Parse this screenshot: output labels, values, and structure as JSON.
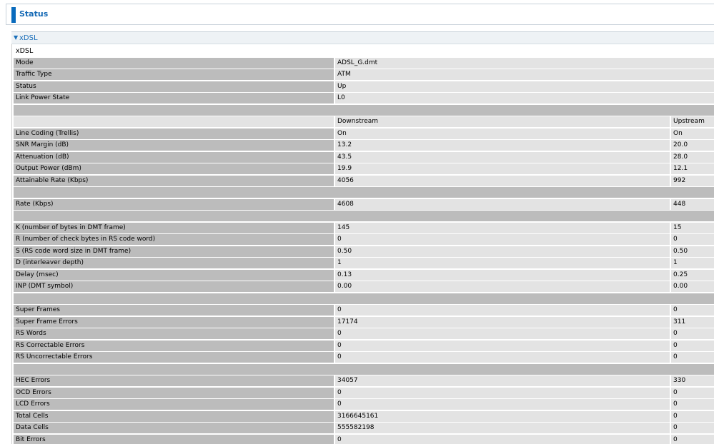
{
  "header": {
    "title": "Status"
  },
  "section": {
    "title": "xDSL"
  },
  "table": {
    "title": "xDSL",
    "info": [
      {
        "label": "Mode",
        "value": "ADSL_G.dmt"
      },
      {
        "label": "Traffic Type",
        "value": "ATM"
      },
      {
        "label": "Status",
        "value": "Up"
      },
      {
        "label": "Link Power State",
        "value": "L0"
      }
    ],
    "columns": {
      "downstream": "Downstream",
      "upstream": "Upstream"
    },
    "groups": [
      [
        {
          "label": "Line Coding (Trellis)",
          "down": "On",
          "up": "On"
        },
        {
          "label": "SNR Margin (dB)",
          "down": "13.2",
          "up": "20.0"
        },
        {
          "label": "Attenuation (dB)",
          "down": "43.5",
          "up": "28.0"
        },
        {
          "label": "Output Power (dBm)",
          "down": "19.9",
          "up": "12.1"
        },
        {
          "label": "Attainable Rate (Kbps)",
          "down": "4056",
          "up": "992"
        }
      ],
      [
        {
          "label": "Rate (Kbps)",
          "down": "4608",
          "up": "448"
        }
      ],
      [
        {
          "label": "K (number of bytes in DMT frame)",
          "down": "145",
          "up": "15"
        },
        {
          "label": "R (number of check bytes in RS code word)",
          "down": "0",
          "up": "0"
        },
        {
          "label": "S (RS code word size in DMT frame)",
          "down": "0.50",
          "up": "0.50"
        },
        {
          "label": "D (interleaver depth)",
          "down": "1",
          "up": "1"
        },
        {
          "label": "Delay (msec)",
          "down": "0.13",
          "up": "0.25"
        },
        {
          "label": "INP (DMT symbol)",
          "down": "0.00",
          "up": "0.00"
        }
      ],
      [
        {
          "label": "Super Frames",
          "down": "0",
          "up": "0"
        },
        {
          "label": "Super Frame Errors",
          "down": "17174",
          "up": "311"
        },
        {
          "label": "RS Words",
          "down": "0",
          "up": "0"
        },
        {
          "label": "RS Correctable Errors",
          "down": "0",
          "up": "0"
        },
        {
          "label": "RS Uncorrectable Errors",
          "down": "0",
          "up": "0"
        }
      ],
      [
        {
          "label": "HEC Errors",
          "down": "34057",
          "up": "330"
        },
        {
          "label": "OCD Errors",
          "down": "0",
          "up": "0"
        },
        {
          "label": "LCD Errors",
          "down": "0",
          "up": "0"
        },
        {
          "label": "Total Cells",
          "down": "3166645161",
          "up": "0"
        },
        {
          "label": "Data Cells",
          "down": "555582198",
          "up": "0"
        },
        {
          "label": "Bit Errors",
          "down": "0",
          "up": "0"
        }
      ]
    ]
  }
}
